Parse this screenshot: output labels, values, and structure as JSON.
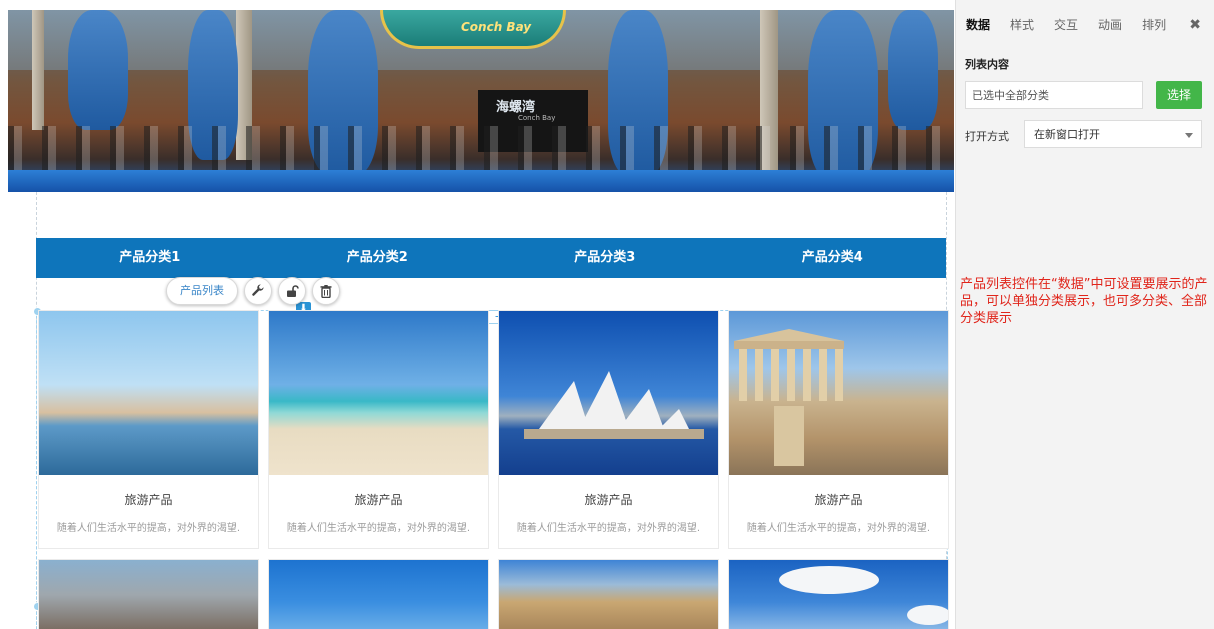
{
  "banner": {
    "sign_text": "Conch Bay",
    "door_text": "海螺湾",
    "door_sub": "Conch Bay"
  },
  "category_nav": {
    "items": [
      "产品分类1",
      "产品分类2",
      "产品分类3",
      "产品分类4"
    ]
  },
  "toolbar": {
    "label": "产品列表"
  },
  "products": [
    {
      "title": "旅游产品",
      "desc": "随着人们生活水平的提高，对外界的渴望."
    },
    {
      "title": "旅游产品",
      "desc": "随着人们生活水平的提高，对外界的渴望."
    },
    {
      "title": "旅游产品",
      "desc": "随着人们生活水平的提高，对外界的渴望."
    },
    {
      "title": "旅游产品",
      "desc": "随着人们生活水平的提高，对外界的渴望."
    }
  ],
  "panel": {
    "tabs": [
      "数据",
      "样式",
      "交互",
      "动画",
      "排列"
    ],
    "active_tab": "数据",
    "close_glyph": "✖",
    "section_label": "列表内容",
    "category_value": "已选中全部分类",
    "select_button": "选择",
    "open_label": "打开方式",
    "open_value": "在新窗口打开"
  },
  "annotation": "产品列表控件在“数据”中可设置要展示的产品，可以单独分类展示，也可多分类、全部分类展示",
  "colors": {
    "nav_blue": "#0e75bb",
    "select_green": "#43b649",
    "note_red": "#e0251b"
  }
}
